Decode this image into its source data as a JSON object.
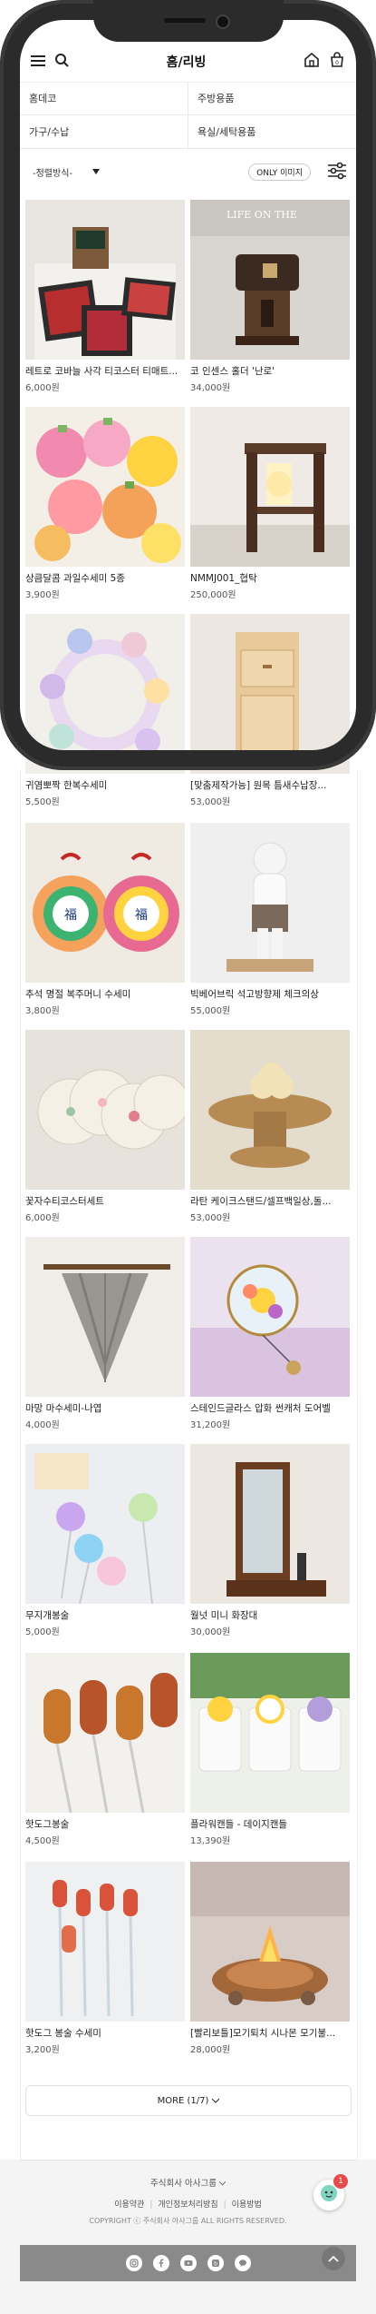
{
  "header": {
    "title": "홈/리빙"
  },
  "categories": [
    [
      "홈데코",
      "주방용품"
    ],
    [
      "가구/수납",
      "욕실/세탁용품"
    ]
  ],
  "sortbar": {
    "sort_label": "-정렬방식-",
    "only_label": "ONLY 이미지"
  },
  "products": [
    {
      "name": "레트로 코바늘 사각 티코스터 티매트...",
      "price": "6,000원",
      "art": "coaster"
    },
    {
      "name": "코 인센스 홀더 '난로'",
      "price": "34,000원",
      "art": "incense"
    },
    {
      "name": "상큼달콤 과일수세미 5종",
      "price": "3,900원",
      "art": "fruit"
    },
    {
      "name": "NMMJ001_협탁",
      "price": "250,000원",
      "art": "shelf"
    },
    {
      "name": "귀염뽀짝 한복수세미",
      "price": "5,500원",
      "art": "hanbok"
    },
    {
      "name": "[맞춤제작가능] 원목 틈새수납장...",
      "price": "53,000원",
      "art": "cabinet"
    },
    {
      "name": "추석 명절 복주머니 수세미",
      "price": "3,800원",
      "art": "pouch"
    },
    {
      "name": "빅베어브릭 석고방향제 체크의상",
      "price": "55,000원",
      "art": "bear"
    },
    {
      "name": "꽃자수티코스터세트",
      "price": "6,000원",
      "art": "embroidery"
    },
    {
      "name": "라탄 케이크스탠드/셀프백일상,돌...",
      "price": "53,000원",
      "art": "rattan"
    },
    {
      "name": "마망 마수세미-나엽",
      "price": "4,000원",
      "art": "leaf"
    },
    {
      "name": "스테인드글라스 압화 썬캐처 도어벨",
      "price": "31,200원",
      "art": "suncatcher"
    },
    {
      "name": "무지개봉술",
      "price": "5,000원",
      "art": "rainbow"
    },
    {
      "name": "월넛 미니 화장대",
      "price": "30,000원",
      "art": "mirror"
    },
    {
      "name": "핫도그봉술",
      "price": "4,500원",
      "art": "hotdog"
    },
    {
      "name": "플라워캔들 - 데이지캔들",
      "price": "13,390원",
      "art": "candle"
    },
    {
      "name": "핫도그 봉술 수세미",
      "price": "3,200원",
      "art": "hotdog2"
    },
    {
      "name": "[빨리보틀]모기퇴치 시나몬 모기불...",
      "price": "28,000원",
      "art": "campfire"
    }
  ],
  "more_label": "MORE (1/7)",
  "footer": {
    "company": "주식회사 아사그룹",
    "links": [
      "이용약관",
      "개인정보처리방침",
      "이용방법"
    ],
    "copyright": "COPYRIGHT ⓒ 주식회사 아사그룹 ALL RIGHTS RESERVED."
  },
  "chat_badge": "1",
  "icons": [
    "menu-icon",
    "search-icon",
    "home-icon",
    "cart-icon",
    "chevron-down-icon",
    "filter-icon",
    "instagram-icon",
    "facebook-icon",
    "youtube-icon",
    "blog-icon",
    "kakao-icon",
    "arrow-up-icon",
    "chat-icon"
  ]
}
